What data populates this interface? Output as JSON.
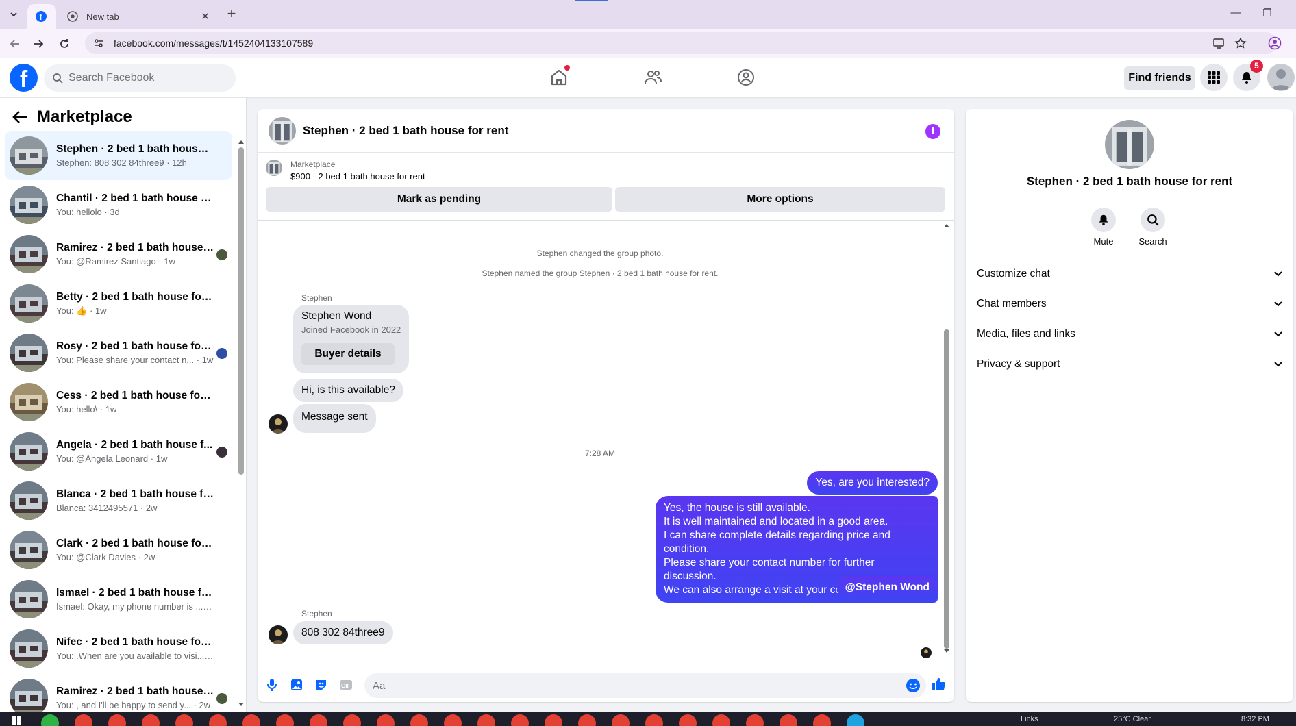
{
  "browser": {
    "active_tab_icon": "facebook-icon",
    "tabs": [
      {
        "title": "",
        "icon": "facebook-icon"
      },
      {
        "title": "New tab",
        "icon": "chrome-icon"
      }
    ],
    "url": "facebook.com/messages/t/1452404133107589"
  },
  "fb_nav": {
    "logo": "f",
    "search_placeholder": "Search Facebook",
    "find_friends": "Find friends",
    "notifications_count": "5"
  },
  "left_panel": {
    "title": "Marketplace",
    "conversations": [
      {
        "title": "Stephen · 2 bed 1 bath house for...",
        "subtitle": "Stephen: 808 302 84three9 · 12h",
        "selected": true
      },
      {
        "title": "Chantil · 2 bed 1 bath house for ...",
        "subtitle": "You: hellolo · 3d"
      },
      {
        "title": "Ramirez · 2 bed 1 bath house f...",
        "subtitle": "You: @Ramirez Santiago · 1w"
      },
      {
        "title": "Betty · 2 bed 1 bath house for rent",
        "subtitle": "You: 👍 · 1w"
      },
      {
        "title": "Rosy · 2 bed 1 bath house for ...",
        "subtitle": "You: Please share your contact n... · 1w"
      },
      {
        "title": "Cess · 2 bed 1 bath house for rent",
        "subtitle": "You: hello\\ · 1w"
      },
      {
        "title": "Angela · 2 bed 1 bath house f...",
        "subtitle": "You: @Angela Leonard · 1w"
      },
      {
        "title": "Blanca · 2 bed 1 bath house for r...",
        "subtitle": "Blanca: 3412495571 · 2w"
      },
      {
        "title": "Clark · 2 bed 1 bath house for rent",
        "subtitle": "You: @Clark Davies · 2w"
      },
      {
        "title": "Ismael · 2 bed 1 bath house for r...",
        "subtitle": "Ismael: Okay, my phone number is ... · 2w"
      },
      {
        "title": "Nifec · 2 bed 1 bath house for rent",
        "subtitle": "You: .When are you available to visi... · 2w"
      },
      {
        "title": "Ramirez · 2 bed 1 bath house f...",
        "subtitle": "You: , and I'll be happy to send y... · 2w"
      }
    ]
  },
  "chat": {
    "title": "Stephen · 2 bed 1 bath house for rent",
    "listing_label": "Marketplace",
    "listing_price": "$900 - 2 bed 1 bath house for rent",
    "mark_pending": "Mark as pending",
    "more_options": "More options",
    "system_messages": [
      "Stephen changed the group photo.",
      "Stephen named the group Stephen · 2 bed 1 bath house for rent."
    ],
    "sender": "Stephen",
    "card": {
      "name": "Stephen Wond",
      "joined": "Joined Facebook in 2022",
      "button": "Buyer details"
    },
    "incoming_1": "Hi, is this available?",
    "incoming_2": "Message sent",
    "timestamp": "7:28 AM",
    "outgoing_1": "Yes, are you interested?",
    "outgoing_2_lines": [
      "Yes, the house is still available.",
      "It is well maintained and located in a good area.",
      "I can share complete details regarding price and condition.",
      "Please share your contact number for further discussion.",
      "We can also arrange a visit at your convenience"
    ],
    "outgoing_3": "@Stephen Wond",
    "incoming_3": "808 302 84three9",
    "composer_placeholder": "Aa"
  },
  "right_panel": {
    "name": "Stephen · 2 bed 1 bath house for rent",
    "mute": "Mute",
    "search": "Search",
    "sections": [
      "Customize chat",
      "Chat members",
      "Media, files and links",
      "Privacy & support"
    ]
  },
  "taskbar": {
    "links": "Links",
    "weather": "25°C  Clear",
    "time": "8:32 PM"
  },
  "colors": {
    "fb_blue": "#0866ff",
    "outgoing_bubble": "#4a3ff2",
    "info_purple": "#a033ff",
    "selected_row": "#ebf5ff"
  }
}
